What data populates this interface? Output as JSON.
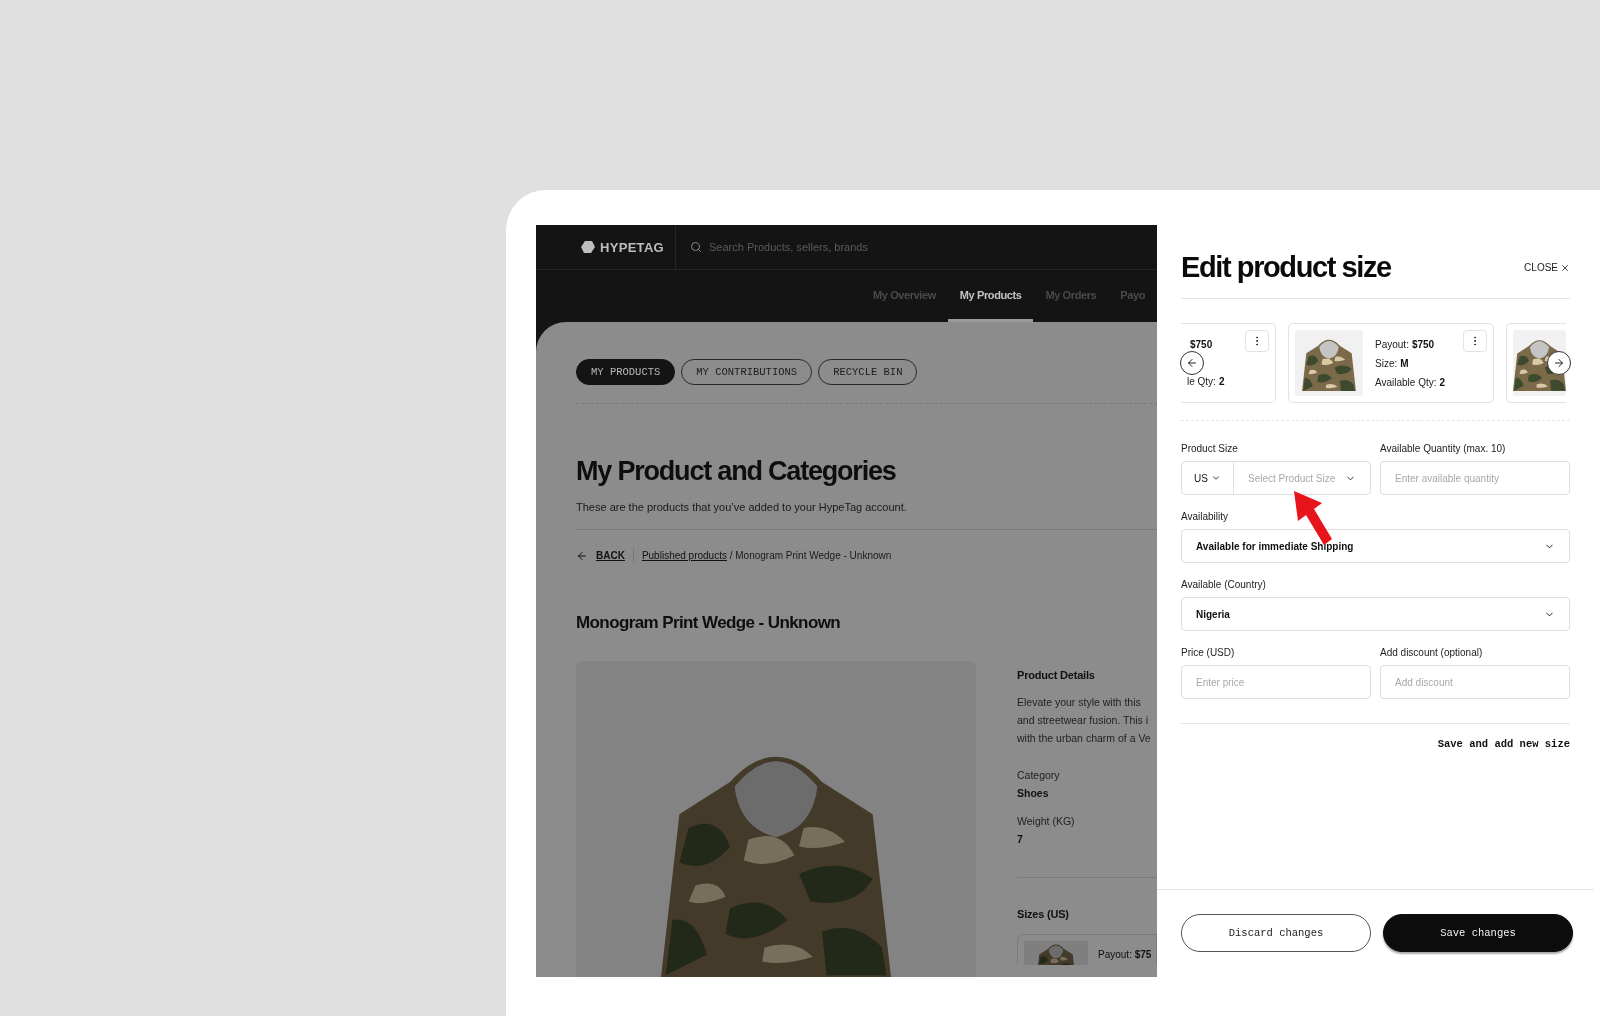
{
  "app": {
    "logo": "HYPETAG",
    "search": {
      "placeholder": "Search Products, sellers, brands"
    },
    "nav": [
      {
        "label": "My Overview",
        "selected": false
      },
      {
        "label": "My Products",
        "selected": true
      },
      {
        "label": "My Orders",
        "selected": false
      },
      {
        "label": "Payo",
        "selected": false
      }
    ],
    "segments": [
      {
        "label": "MY PRODUCTS",
        "selected": true
      },
      {
        "label": "MY CONTRIBUTIONS",
        "selected": false
      },
      {
        "label": "RECYCLE BIN",
        "selected": false
      }
    ],
    "page_title": "My Product and Categories",
    "page_subtitle": "These are the products that you’ve added to your HypeTag account.",
    "breadcrumb": {
      "back": "BACK",
      "link": "Published products",
      "current": "/ Monogram Print Wedge - Unknown"
    },
    "product_title": "Monogram Print Wedge - Unknown",
    "details": {
      "heading": "Product Details",
      "description": [
        "Elevate your style with this",
        "and streetwear fusion. This i",
        "with the urban charm of a Ve"
      ],
      "fields": [
        {
          "label": "Category",
          "value": "Shoes"
        },
        {
          "label": "Weight (KG)",
          "value": "7"
        }
      ]
    },
    "sizes": {
      "heading": "Sizes (US)",
      "card": {
        "label": "Payout:",
        "value": "$75"
      }
    }
  },
  "drawer": {
    "title": "Edit product size",
    "close": "CLOSE",
    "carousel": [
      {
        "kind": "partial-left",
        "lines": [
          {
            "value": "$750"
          },
          {
            "label": "le Qty:",
            "value": "2"
          }
        ]
      },
      {
        "kind": "full",
        "lines": [
          {
            "label": "Payout:",
            "value": "$750"
          },
          {
            "label": "Size:",
            "value": "M"
          },
          {
            "label": "Available Qty:",
            "value": "2"
          }
        ]
      },
      {
        "kind": "partial-right"
      }
    ],
    "form": {
      "product_size": {
        "label": "Product Size",
        "unit": "US",
        "placeholder": "Select Product Size"
      },
      "quantity": {
        "label": "Available Quantity (max. 10)",
        "placeholder": "Enter available quantity"
      },
      "availability": {
        "label": "Availability",
        "value": "Available for immediate Shipping"
      },
      "country": {
        "label": "Available (Country)",
        "value": "Nigeria"
      },
      "price": {
        "label": "Price (USD)",
        "placeholder": "Enter price"
      },
      "discount": {
        "label": "Add discount (optional)",
        "placeholder": "Add discount"
      }
    },
    "save_add": "Save and add new size",
    "buttons": [
      {
        "label": "Discard changes",
        "kind": "secondary"
      },
      {
        "label": "Save changes",
        "kind": "primary"
      }
    ]
  }
}
